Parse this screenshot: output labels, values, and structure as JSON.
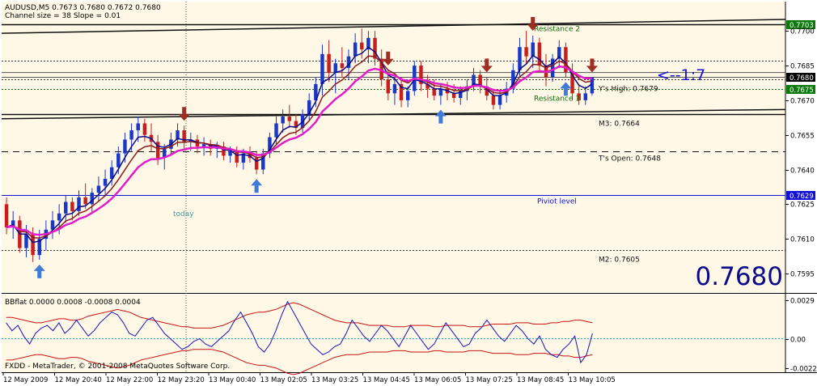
{
  "window": {
    "title": "AUDUSD,M5  0.7673 0.7680 0.7672 0.7680",
    "subtitle": "Channel size = 38 Slope = 0.01",
    "copyright": "FXDD - MetaTrader, © 2001-2008 MetaQuotes Software Corp."
  },
  "colors": {
    "background": "#FFF8E6",
    "bull_candle": "#1A37C8",
    "bear_candle": "#C81E1E",
    "fast_ma": "#0A0A8C",
    "slow_ma": "#8C1A1A",
    "magenta_ma": "#E21EC9",
    "buy_arrow": "#3F7BD8",
    "sell_arrow": "#9E2D22",
    "grid": "#9A9A9A",
    "level_green": "#0B6B0B",
    "pivot_blue": "#1010D8",
    "price_label_bg": "#0B7A0B",
    "indicator_blue": "#1414C8",
    "indicator_red": "#C81414",
    "indicator_zero": "#1AB0B0"
  },
  "chart_data": {
    "type": "candlestick",
    "symbol": "AUDUSD",
    "timeframe": "M5",
    "price_axis": {
      "min": 0.7588,
      "max": 0.7712,
      "ticks": [
        "0.7700",
        "0.7685",
        "0.7670",
        "0.7655",
        "0.7640",
        "0.7625",
        "0.7610",
        "0.7595"
      ]
    },
    "time_axis": {
      "labels": [
        "12 May 2009",
        "12 May 20:40",
        "12 May 22:00",
        "12 May 23:20",
        "13 May 00:40",
        "13 May 02:05",
        "13 May 03:25",
        "13 May 04:45",
        "13 May 06:05",
        "13 May 07:25",
        "13 May 08:45",
        "13 May 10:05"
      ]
    },
    "candles": [
      [
        0.7625,
        0.7628,
        0.7612,
        0.7615
      ],
      [
        0.7615,
        0.7622,
        0.761,
        0.7618
      ],
      [
        0.7618,
        0.762,
        0.7604,
        0.7606
      ],
      [
        0.7606,
        0.7616,
        0.7602,
        0.7612
      ],
      [
        0.7612,
        0.7615,
        0.76,
        0.7603
      ],
      [
        0.7603,
        0.7614,
        0.7601,
        0.761
      ],
      [
        0.761,
        0.7618,
        0.7605,
        0.7614
      ],
      [
        0.7614,
        0.7622,
        0.761,
        0.7618
      ],
      [
        0.7618,
        0.7625,
        0.7612,
        0.7621
      ],
      [
        0.7621,
        0.7629,
        0.7617,
        0.7626
      ],
      [
        0.7626,
        0.7628,
        0.7618,
        0.7622
      ],
      [
        0.7622,
        0.7631,
        0.762,
        0.7628
      ],
      [
        0.7628,
        0.7634,
        0.7623,
        0.7625
      ],
      [
        0.7625,
        0.7632,
        0.7621,
        0.763
      ],
      [
        0.763,
        0.7637,
        0.7626,
        0.7633
      ],
      [
        0.7633,
        0.764,
        0.7629,
        0.7636
      ],
      [
        0.7636,
        0.7644,
        0.7633,
        0.7641
      ],
      [
        0.7641,
        0.765,
        0.7638,
        0.7647
      ],
      [
        0.7647,
        0.7656,
        0.7643,
        0.7653
      ],
      [
        0.7653,
        0.766,
        0.7648,
        0.7657
      ],
      [
        0.7657,
        0.7663,
        0.7652,
        0.766
      ],
      [
        0.766,
        0.7662,
        0.7652,
        0.7655
      ],
      [
        0.7655,
        0.766,
        0.7648,
        0.7652
      ],
      [
        0.7652,
        0.7655,
        0.7642,
        0.7645
      ],
      [
        0.7645,
        0.7651,
        0.764,
        0.7649
      ],
      [
        0.7649,
        0.7656,
        0.7646,
        0.7653
      ],
      [
        0.7653,
        0.766,
        0.765,
        0.7657
      ],
      [
        0.7657,
        0.7659,
        0.7649,
        0.7652
      ],
      [
        0.7652,
        0.7656,
        0.7648,
        0.7653
      ],
      [
        0.7653,
        0.7655,
        0.7647,
        0.765
      ],
      [
        0.765,
        0.7654,
        0.7646,
        0.7651
      ],
      [
        0.7651,
        0.7653,
        0.7646,
        0.7649
      ],
      [
        0.7649,
        0.7652,
        0.7645,
        0.765
      ],
      [
        0.765,
        0.7652,
        0.7644,
        0.7646
      ],
      [
        0.7646,
        0.765,
        0.7643,
        0.7648
      ],
      [
        0.7648,
        0.765,
        0.7641,
        0.7643
      ],
      [
        0.7643,
        0.7649,
        0.764,
        0.7647
      ],
      [
        0.7647,
        0.765,
        0.7643,
        0.7645
      ],
      [
        0.7645,
        0.7648,
        0.7638,
        0.764
      ],
      [
        0.764,
        0.7649,
        0.7638,
        0.7647
      ],
      [
        0.7647,
        0.7656,
        0.7645,
        0.7654
      ],
      [
        0.7654,
        0.7663,
        0.7651,
        0.766
      ],
      [
        0.766,
        0.7666,
        0.7656,
        0.7663
      ],
      [
        0.7663,
        0.7668,
        0.7658,
        0.7661
      ],
      [
        0.7661,
        0.7664,
        0.7655,
        0.7658
      ],
      [
        0.7658,
        0.7666,
        0.7656,
        0.7664
      ],
      [
        0.7664,
        0.7673,
        0.7661,
        0.767
      ],
      [
        0.767,
        0.768,
        0.7667,
        0.7677
      ],
      [
        0.7677,
        0.7694,
        0.7672,
        0.769
      ],
      [
        0.769,
        0.7696,
        0.7678,
        0.7682
      ],
      [
        0.7682,
        0.7688,
        0.7673,
        0.7686
      ],
      [
        0.7686,
        0.7693,
        0.768,
        0.7684
      ],
      [
        0.7684,
        0.7692,
        0.7679,
        0.7689
      ],
      [
        0.7689,
        0.7699,
        0.7686,
        0.7695
      ],
      [
        0.7695,
        0.7701,
        0.7688,
        0.7692
      ],
      [
        0.7692,
        0.77,
        0.7686,
        0.7697
      ],
      [
        0.7697,
        0.77,
        0.7685,
        0.7688
      ],
      [
        0.7688,
        0.7692,
        0.7676,
        0.7679
      ],
      [
        0.7679,
        0.7683,
        0.767,
        0.7673
      ],
      [
        0.7673,
        0.768,
        0.7668,
        0.7677
      ],
      [
        0.7677,
        0.768,
        0.7667,
        0.767
      ],
      [
        0.767,
        0.7676,
        0.7667,
        0.7674
      ],
      [
        0.7674,
        0.7687,
        0.7672,
        0.7685
      ],
      [
        0.7685,
        0.7687,
        0.7674,
        0.7677
      ],
      [
        0.7677,
        0.7681,
        0.7671,
        0.7675
      ],
      [
        0.7675,
        0.7679,
        0.767,
        0.7672
      ],
      [
        0.7672,
        0.7677,
        0.7668,
        0.7675
      ],
      [
        0.7675,
        0.7678,
        0.767,
        0.7673
      ],
      [
        0.7673,
        0.7677,
        0.7669,
        0.7671
      ],
      [
        0.7671,
        0.7676,
        0.7668,
        0.7674
      ],
      [
        0.7674,
        0.7679,
        0.767,
        0.7676
      ],
      [
        0.7676,
        0.7684,
        0.7674,
        0.7681
      ],
      [
        0.7681,
        0.7683,
        0.7673,
        0.7676
      ],
      [
        0.7676,
        0.768,
        0.767,
        0.7672
      ],
      [
        0.7672,
        0.7675,
        0.7666,
        0.7668
      ],
      [
        0.7668,
        0.7674,
        0.7666,
        0.7672
      ],
      [
        0.7672,
        0.7678,
        0.7669,
        0.7675
      ],
      [
        0.7675,
        0.7686,
        0.7673,
        0.7683
      ],
      [
        0.7683,
        0.7697,
        0.768,
        0.7693
      ],
      [
        0.7693,
        0.77,
        0.7686,
        0.7689
      ],
      [
        0.7689,
        0.7698,
        0.7684,
        0.7695
      ],
      [
        0.7695,
        0.7697,
        0.7682,
        0.7685
      ],
      [
        0.7685,
        0.769,
        0.7676,
        0.768
      ],
      [
        0.768,
        0.769,
        0.7678,
        0.7688
      ],
      [
        0.7688,
        0.7696,
        0.7684,
        0.7693
      ],
      [
        0.7693,
        0.7695,
        0.768,
        0.7682
      ],
      [
        0.7682,
        0.7686,
        0.767,
        0.7673
      ],
      [
        0.7673,
        0.7677,
        0.7668,
        0.767
      ],
      [
        0.767,
        0.7676,
        0.7668,
        0.7673
      ],
      [
        0.7673,
        0.768,
        0.7672,
        0.768
      ]
    ],
    "moving_averages": [
      "fast_ma",
      "slow_ma",
      "magenta_ma"
    ],
    "signals": {
      "buy_candles": [
        5,
        38,
        66,
        85
      ],
      "sell_candles": [
        27,
        58,
        73,
        80,
        99
      ]
    },
    "levels": [
      {
        "value": 0.7703,
        "style": "solid",
        "color": "#111111",
        "axis_label": "0.7703",
        "label": "Resistance 2"
      },
      {
        "value": 0.7687,
        "style": "dotted",
        "color": "#333333",
        "label": ""
      },
      {
        "value": 0.768,
        "style": "solid",
        "color": "#555555",
        "axis_label": "0.7680",
        "label": ""
      },
      {
        "value": 0.7679,
        "style": "dotted",
        "color": "#333333",
        "label": "Y's High: 0.7679"
      },
      {
        "value": 0.7675,
        "style": "dotted",
        "color": "#0B6B0B",
        "axis_label": "0.7675",
        "label": "Resistance 1"
      },
      {
        "value": 0.7664,
        "style": "solid",
        "color": "#111111",
        "label": "M3: 0.7664"
      },
      {
        "value": 0.7648,
        "style": "dashed",
        "color": "#111111",
        "label": "T's Open: 0.7648"
      },
      {
        "value": 0.7629,
        "style": "solid",
        "color": "#1010D8",
        "axis_label": "0.7629",
        "label": "Piviot level"
      },
      {
        "value": 0.7605,
        "style": "dotted",
        "color": "#333333",
        "label": "M2: 0.7605"
      }
    ],
    "annotations": {
      "today_label": "today",
      "arrow_text": "<--1:7",
      "big_price": "0.7680"
    },
    "indicator": {
      "title": "BBflat 0.0000 0.0008 -0.0008 0.0004",
      "min": -0.0024,
      "max": 0.0032,
      "ticks": [
        "0.0029",
        "0.00",
        "-0.0022"
      ],
      "main": [
        0.0012,
        0.0006,
        0.001,
        0.0002,
        -0.0004,
        0.0004,
        0.0008,
        0.001,
        0.0006,
        0.0012,
        0.0004,
        0.0008,
        0.0014,
        0.0008,
        0.0002,
        0.0006,
        0.0012,
        0.0016,
        0.002,
        0.0018,
        0.0012,
        0.0004,
        0.0002,
        0.0008,
        0.0014,
        0.0016,
        0.001,
        0.0004,
        0.0,
        -0.0004,
        -0.0008,
        -0.0006,
        -0.0002,
        0.0,
        -0.0004,
        -0.0006,
        -0.0002,
        0.0002,
        0.0006,
        0.0014,
        0.002,
        0.0012,
        0.0004,
        -0.0006,
        -0.001,
        -0.0004,
        0.0006,
        0.0018,
        0.0028,
        0.002,
        0.0012,
        0.0004,
        -0.0004,
        -0.0008,
        -0.0012,
        -0.001,
        -0.0006,
        -0.0004,
        0.0004,
        0.0014,
        0.0008,
        0.0002,
        -0.0002,
        0.0004,
        0.001,
        0.0006,
        0.0,
        -0.0006,
        0.0002,
        0.001,
        0.0004,
        -0.0002,
        -0.0008,
        -0.0004,
        0.0004,
        0.0012,
        0.0006,
        0.0,
        -0.0006,
        -0.0004,
        0.0004,
        0.0008,
        0.0014,
        0.0008,
        0.0002,
        -0.0002,
        0.0004,
        0.001,
        0.0006,
        0.0,
        -0.0004,
        0.0002,
        -0.0008,
        -0.0012,
        -0.0014,
        -0.0008,
        -0.0004,
        0.0002,
        -0.0018,
        -0.0012,
        0.0004
      ],
      "upper": [
        0.0016,
        0.0016,
        0.0015,
        0.0014,
        0.0013,
        0.0012,
        0.0012,
        0.0013,
        0.0014,
        0.0015,
        0.0015,
        0.0014,
        0.0014,
        0.0015,
        0.0017,
        0.0018,
        0.0019,
        0.002,
        0.0021,
        0.0022,
        0.0021,
        0.002,
        0.0018,
        0.0016,
        0.0015,
        0.0014,
        0.0013,
        0.0012,
        0.0011,
        0.001,
        0.0009,
        0.0009,
        0.0008,
        0.0008,
        0.0008,
        0.0008,
        0.0009,
        0.001,
        0.0012,
        0.0014,
        0.0016,
        0.0018,
        0.0019,
        0.002,
        0.002,
        0.0021,
        0.0022,
        0.0024,
        0.0026,
        0.0027,
        0.0026,
        0.0024,
        0.0022,
        0.002,
        0.0018,
        0.0016,
        0.0014,
        0.0013,
        0.0012,
        0.0012,
        0.0012,
        0.0011,
        0.001,
        0.001,
        0.001,
        0.001,
        0.0009,
        0.0009,
        0.0009,
        0.001,
        0.001,
        0.001,
        0.001,
        0.0009,
        0.0009,
        0.001,
        0.001,
        0.001,
        0.001,
        0.0009,
        0.0009,
        0.0009,
        0.001,
        0.0011,
        0.0011,
        0.0011,
        0.0011,
        0.0012,
        0.0012,
        0.0012,
        0.0011,
        0.0011,
        0.0011,
        0.0012,
        0.0012,
        0.0013,
        0.0013,
        0.0014,
        0.0014,
        0.0013,
        0.0012
      ],
      "lower": [
        -0.0016,
        -0.0016,
        -0.0015,
        -0.0014,
        -0.0013,
        -0.0012,
        -0.0012,
        -0.0013,
        -0.0014,
        -0.0015,
        -0.0015,
        -0.0014,
        -0.0014,
        -0.0015,
        -0.0017,
        -0.0018,
        -0.0019,
        -0.002,
        -0.0021,
        -0.0022,
        -0.0021,
        -0.002,
        -0.0018,
        -0.0016,
        -0.0015,
        -0.0014,
        -0.0013,
        -0.0012,
        -0.0011,
        -0.001,
        -0.0009,
        -0.0009,
        -0.0008,
        -0.0008,
        -0.0008,
        -0.0008,
        -0.0009,
        -0.001,
        -0.0012,
        -0.0014,
        -0.0016,
        -0.0018,
        -0.0019,
        -0.002,
        -0.002,
        -0.0021,
        -0.0022,
        -0.0024,
        -0.0026,
        -0.0027,
        -0.0026,
        -0.0024,
        -0.0022,
        -0.002,
        -0.0018,
        -0.0016,
        -0.0014,
        -0.0013,
        -0.0012,
        -0.0012,
        -0.0012,
        -0.0011,
        -0.001,
        -0.001,
        -0.001,
        -0.001,
        -0.0009,
        -0.0009,
        -0.0009,
        -0.001,
        -0.001,
        -0.001,
        -0.001,
        -0.0009,
        -0.0009,
        -0.001,
        -0.001,
        -0.001,
        -0.001,
        -0.0009,
        -0.0009,
        -0.0009,
        -0.001,
        -0.0011,
        -0.0011,
        -0.0011,
        -0.0011,
        -0.0012,
        -0.0012,
        -0.0012,
        -0.0011,
        -0.0011,
        -0.0011,
        -0.0012,
        -0.0012,
        -0.0013,
        -0.0013,
        -0.0014,
        -0.0014,
        -0.0013,
        -0.0012
      ]
    }
  }
}
